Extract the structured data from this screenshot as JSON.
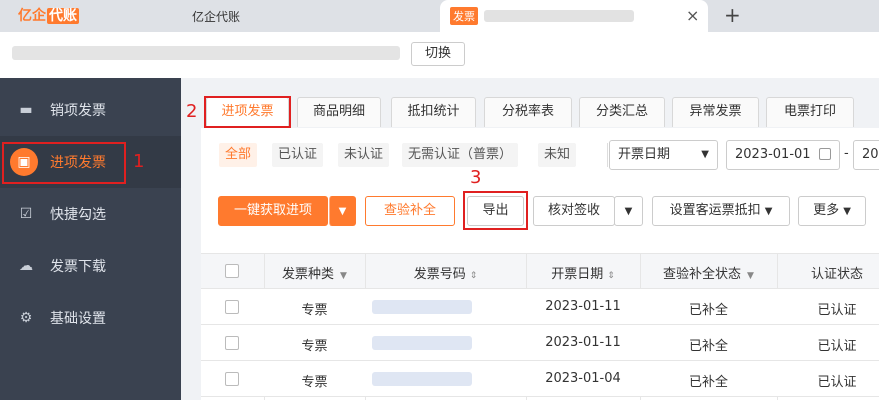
{
  "browser": {
    "logo_text": "亿企",
    "logo_boxed": "代账",
    "tab1_title": "亿企代账",
    "tab2_icon_text": "发票",
    "new_tab": "+",
    "close": "×"
  },
  "company_bar": {
    "switch_label": "切换"
  },
  "sidebar": {
    "items": [
      {
        "label": "销项发票",
        "icon": "ticket-icon"
      },
      {
        "label": "进项发票",
        "icon": "briefcase-icon",
        "active": true
      },
      {
        "label": "快捷勾选",
        "icon": "checkbox-icon"
      },
      {
        "label": "发票下载",
        "icon": "cloud-download-icon"
      },
      {
        "label": "基础设置",
        "icon": "gear-icon"
      }
    ]
  },
  "annotations": {
    "n1": "1",
    "n2": "2",
    "n3": "3"
  },
  "tabs": [
    "进项发票",
    "商品明细",
    "抵扣统计",
    "分税率表",
    "分类汇总",
    "异常发票",
    "电票打印"
  ],
  "filters": [
    "全部",
    "已认证",
    "未认证",
    "无需认证（普票）",
    "未知"
  ],
  "date_select": {
    "value": "开票日期"
  },
  "date_from": "2023-01-01",
  "date_to_prefix": "20",
  "date_sep": "-",
  "actions": {
    "fetch": "一键获取进项",
    "verify": "查验补全",
    "export": "导出",
    "check_sign": "核对签收",
    "freight": "设置客运票抵扣",
    "more": "更多"
  },
  "table": {
    "headers": [
      "发票种类",
      "发票号码",
      "开票日期",
      "查验补全状态",
      "认证状态"
    ],
    "rows": [
      {
        "type": "专票",
        "date": "2023-01-11",
        "verify": "已补全",
        "auth": "已认证"
      },
      {
        "type": "专票",
        "date": "2023-01-11",
        "verify": "已补全",
        "auth": "已认证"
      },
      {
        "type": "专票",
        "date": "2023-01-04",
        "verify": "已补全",
        "auth": "已认证"
      }
    ]
  },
  "colors": {
    "accent": "#ff7a2e",
    "sidebar": "#3a4250",
    "annotation": "#e02020"
  }
}
